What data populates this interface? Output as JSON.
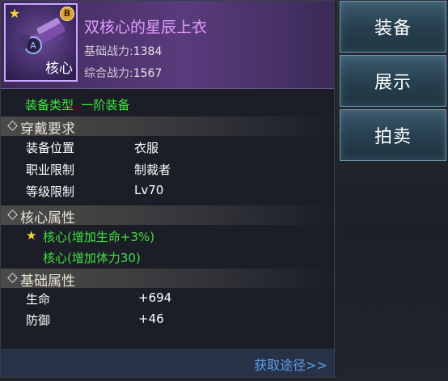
{
  "item": {
    "name": "双核心的星辰上衣",
    "core_label": "核心",
    "badge": "B",
    "base_power_label": "基础战力:",
    "base_power": "1384",
    "total_power_label": "综合战力:",
    "total_power": "1567"
  },
  "type_line": "装备类型  一阶装备",
  "requirements": {
    "title": "穿戴要求",
    "rows": [
      {
        "label": "装备位置",
        "value": "衣服"
      },
      {
        "label": "职业限制",
        "value": "制裁者"
      },
      {
        "label": "等级限制",
        "value": "Lv70"
      }
    ]
  },
  "core_attrs": {
    "title": "核心属性",
    "items": [
      "核心(增加生命+3%)",
      "核心(增加体力30)"
    ]
  },
  "base_attrs": {
    "title": "基础属性",
    "rows": [
      {
        "label": "生命",
        "value": "+694"
      },
      {
        "label": "防御",
        "value": "+46"
      }
    ]
  },
  "footer_link": "获取途径>>",
  "side_buttons": [
    "装备",
    "展示",
    "拍卖"
  ],
  "colors": {
    "name": "#e59cff",
    "green": "#41e041",
    "link": "#5a9ce8",
    "header": "#5a3b7c"
  },
  "icons": [
    "star-icon",
    "diamond-icon",
    "b-badge-icon",
    "gun-icon"
  ]
}
